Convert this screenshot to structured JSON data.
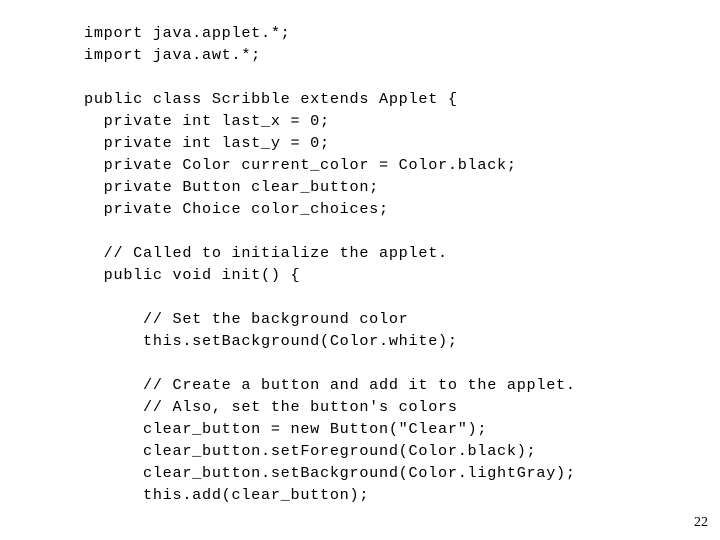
{
  "slide": {
    "page_number": "22",
    "background_color": "#ffffff",
    "text_color": "#000000",
    "code_lines": [
      "import java.applet.*;",
      "import java.awt.*;",
      "",
      "public class Scribble extends Applet {",
      "  private int last_x = 0;",
      "  private int last_y = 0;",
      "  private Color current_color = Color.black;",
      "  private Button clear_button;",
      "  private Choice color_choices;",
      "",
      "  // Called to initialize the applet.",
      "  public void init() {",
      "",
      "      // Set the background color",
      "      this.setBackground(Color.white);",
      "",
      "      // Create a button and add it to the applet.",
      "      // Also, set the button's colors",
      "      clear_button = new Button(\"Clear\");",
      "      clear_button.setForeground(Color.black);",
      "      clear_button.setBackground(Color.lightGray);",
      "      this.add(clear_button);"
    ]
  }
}
